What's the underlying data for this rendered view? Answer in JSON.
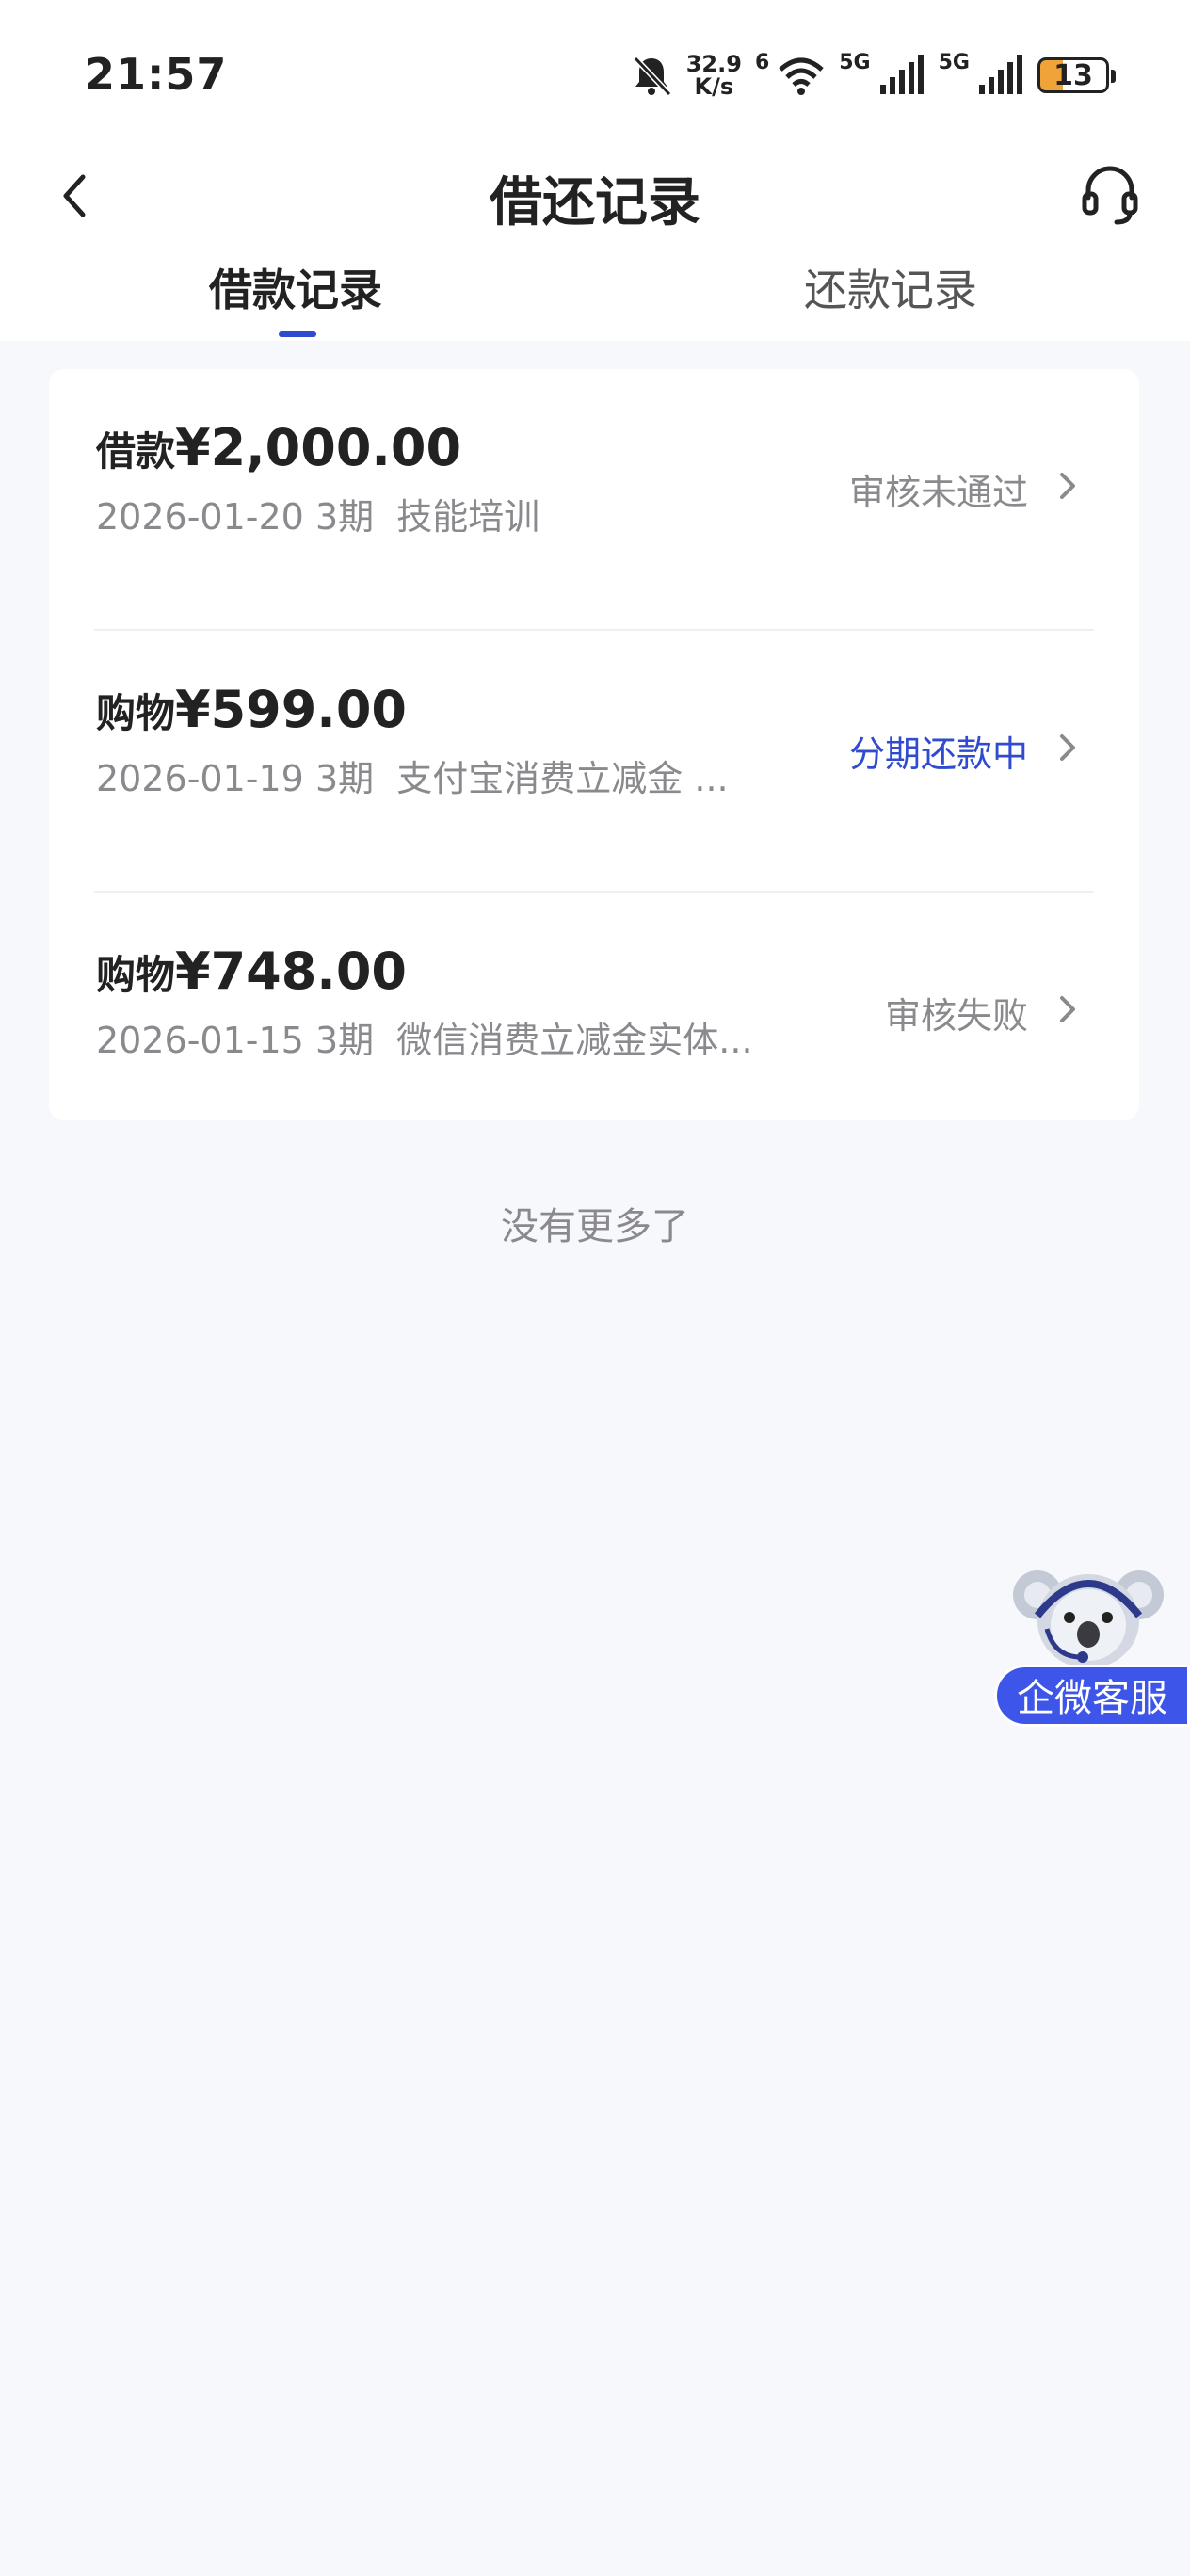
{
  "status_bar": {
    "time": "21:57",
    "net_speed_value": "32.9",
    "net_speed_unit": "K/s",
    "wifi_badge": "6",
    "sim1_label": "5G",
    "sim2_label": "5G",
    "battery_level": "13",
    "icons": [
      "bell-off-icon",
      "wifi-icon",
      "signal-icon",
      "battery-icon"
    ]
  },
  "header": {
    "title": "借还记录",
    "back_icon": "chevron-left-icon",
    "support_icon": "headset-icon"
  },
  "tabs": [
    {
      "label": "借款记录",
      "active": true
    },
    {
      "label": "还款记录",
      "active": false
    }
  ],
  "records": [
    {
      "type": "借款",
      "amount": "¥2,000.00",
      "date": "2026-01-20",
      "periods": "3期",
      "purpose": "技能培训",
      "status": "审核未通过",
      "status_color": "#8a8a8e"
    },
    {
      "type": "购物",
      "amount": "¥599.00",
      "date": "2026-01-19",
      "periods": "3期",
      "purpose": "支付宝消费立减金 ...",
      "status": "分期还款中",
      "status_color": "#2f4bd0"
    },
    {
      "type": "购物",
      "amount": "¥748.00",
      "date": "2026-01-15",
      "periods": "3期",
      "purpose": "微信消费立减金实体...",
      "status": "审核失败",
      "status_color": "#8a8a8e"
    }
  ],
  "footer": {
    "no_more": "没有更多了"
  },
  "floating_service": {
    "label": "企微客服",
    "icon": "koala-mascot-icon"
  },
  "colors": {
    "accent": "#2f4bd0",
    "background": "#f7f8fc",
    "muted": "#8a8a8e"
  }
}
